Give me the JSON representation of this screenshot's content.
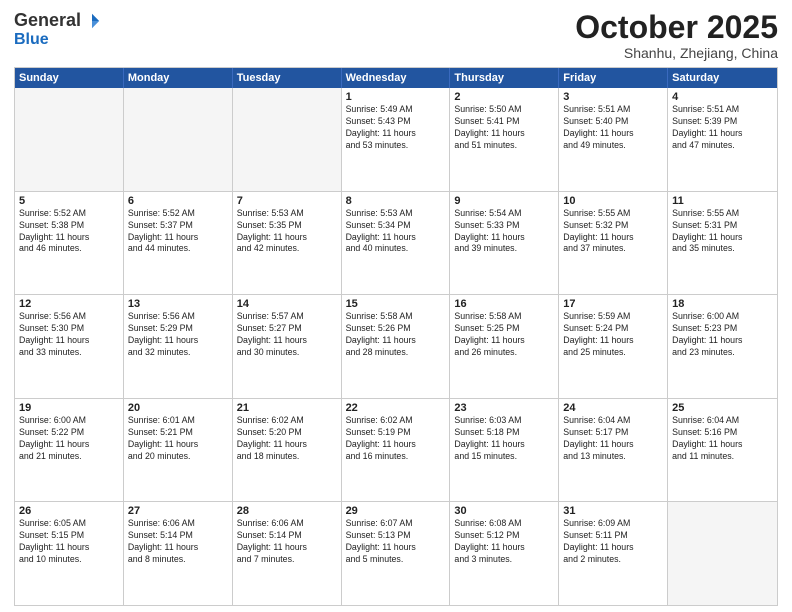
{
  "logo": {
    "general": "General",
    "blue": "Blue"
  },
  "title": "October 2025",
  "location": "Shanhu, Zhejiang, China",
  "days": [
    "Sunday",
    "Monday",
    "Tuesday",
    "Wednesday",
    "Thursday",
    "Friday",
    "Saturday"
  ],
  "rows": [
    [
      {
        "date": "",
        "info": ""
      },
      {
        "date": "",
        "info": ""
      },
      {
        "date": "",
        "info": ""
      },
      {
        "date": "1",
        "info": "Sunrise: 5:49 AM\nSunset: 5:43 PM\nDaylight: 11 hours\nand 53 minutes."
      },
      {
        "date": "2",
        "info": "Sunrise: 5:50 AM\nSunset: 5:41 PM\nDaylight: 11 hours\nand 51 minutes."
      },
      {
        "date": "3",
        "info": "Sunrise: 5:51 AM\nSunset: 5:40 PM\nDaylight: 11 hours\nand 49 minutes."
      },
      {
        "date": "4",
        "info": "Sunrise: 5:51 AM\nSunset: 5:39 PM\nDaylight: 11 hours\nand 47 minutes."
      }
    ],
    [
      {
        "date": "5",
        "info": "Sunrise: 5:52 AM\nSunset: 5:38 PM\nDaylight: 11 hours\nand 46 minutes."
      },
      {
        "date": "6",
        "info": "Sunrise: 5:52 AM\nSunset: 5:37 PM\nDaylight: 11 hours\nand 44 minutes."
      },
      {
        "date": "7",
        "info": "Sunrise: 5:53 AM\nSunset: 5:35 PM\nDaylight: 11 hours\nand 42 minutes."
      },
      {
        "date": "8",
        "info": "Sunrise: 5:53 AM\nSunset: 5:34 PM\nDaylight: 11 hours\nand 40 minutes."
      },
      {
        "date": "9",
        "info": "Sunrise: 5:54 AM\nSunset: 5:33 PM\nDaylight: 11 hours\nand 39 minutes."
      },
      {
        "date": "10",
        "info": "Sunrise: 5:55 AM\nSunset: 5:32 PM\nDaylight: 11 hours\nand 37 minutes."
      },
      {
        "date": "11",
        "info": "Sunrise: 5:55 AM\nSunset: 5:31 PM\nDaylight: 11 hours\nand 35 minutes."
      }
    ],
    [
      {
        "date": "12",
        "info": "Sunrise: 5:56 AM\nSunset: 5:30 PM\nDaylight: 11 hours\nand 33 minutes."
      },
      {
        "date": "13",
        "info": "Sunrise: 5:56 AM\nSunset: 5:29 PM\nDaylight: 11 hours\nand 32 minutes."
      },
      {
        "date": "14",
        "info": "Sunrise: 5:57 AM\nSunset: 5:27 PM\nDaylight: 11 hours\nand 30 minutes."
      },
      {
        "date": "15",
        "info": "Sunrise: 5:58 AM\nSunset: 5:26 PM\nDaylight: 11 hours\nand 28 minutes."
      },
      {
        "date": "16",
        "info": "Sunrise: 5:58 AM\nSunset: 5:25 PM\nDaylight: 11 hours\nand 26 minutes."
      },
      {
        "date": "17",
        "info": "Sunrise: 5:59 AM\nSunset: 5:24 PM\nDaylight: 11 hours\nand 25 minutes."
      },
      {
        "date": "18",
        "info": "Sunrise: 6:00 AM\nSunset: 5:23 PM\nDaylight: 11 hours\nand 23 minutes."
      }
    ],
    [
      {
        "date": "19",
        "info": "Sunrise: 6:00 AM\nSunset: 5:22 PM\nDaylight: 11 hours\nand 21 minutes."
      },
      {
        "date": "20",
        "info": "Sunrise: 6:01 AM\nSunset: 5:21 PM\nDaylight: 11 hours\nand 20 minutes."
      },
      {
        "date": "21",
        "info": "Sunrise: 6:02 AM\nSunset: 5:20 PM\nDaylight: 11 hours\nand 18 minutes."
      },
      {
        "date": "22",
        "info": "Sunrise: 6:02 AM\nSunset: 5:19 PM\nDaylight: 11 hours\nand 16 minutes."
      },
      {
        "date": "23",
        "info": "Sunrise: 6:03 AM\nSunset: 5:18 PM\nDaylight: 11 hours\nand 15 minutes."
      },
      {
        "date": "24",
        "info": "Sunrise: 6:04 AM\nSunset: 5:17 PM\nDaylight: 11 hours\nand 13 minutes."
      },
      {
        "date": "25",
        "info": "Sunrise: 6:04 AM\nSunset: 5:16 PM\nDaylight: 11 hours\nand 11 minutes."
      }
    ],
    [
      {
        "date": "26",
        "info": "Sunrise: 6:05 AM\nSunset: 5:15 PM\nDaylight: 11 hours\nand 10 minutes."
      },
      {
        "date": "27",
        "info": "Sunrise: 6:06 AM\nSunset: 5:14 PM\nDaylight: 11 hours\nand 8 minutes."
      },
      {
        "date": "28",
        "info": "Sunrise: 6:06 AM\nSunset: 5:14 PM\nDaylight: 11 hours\nand 7 minutes."
      },
      {
        "date": "29",
        "info": "Sunrise: 6:07 AM\nSunset: 5:13 PM\nDaylight: 11 hours\nand 5 minutes."
      },
      {
        "date": "30",
        "info": "Sunrise: 6:08 AM\nSunset: 5:12 PM\nDaylight: 11 hours\nand 3 minutes."
      },
      {
        "date": "31",
        "info": "Sunrise: 6:09 AM\nSunset: 5:11 PM\nDaylight: 11 hours\nand 2 minutes."
      },
      {
        "date": "",
        "info": ""
      }
    ]
  ]
}
